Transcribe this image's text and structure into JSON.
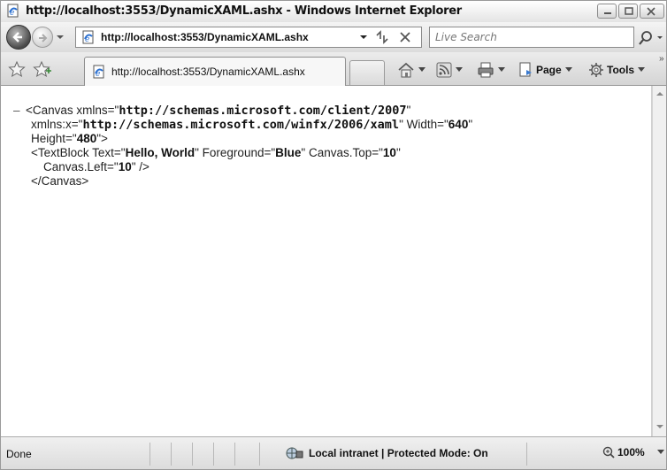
{
  "window": {
    "title": "http://localhost:3553/DynamicXAML.ashx - Windows Internet Explorer"
  },
  "address_bar": {
    "url": "http://localhost:3553/DynamicXAML.ashx"
  },
  "search": {
    "placeholder": "Live Search"
  },
  "tab": {
    "label": "http://localhost:3553/DynamicXAML.ashx"
  },
  "command_bar": {
    "page_label": "Page",
    "tools_label": "Tools"
  },
  "document": {
    "dash": "–",
    "line1": {
      "open": "<Canvas xmlns=\"",
      "value": "http://schemas.microsoft.com/client/2007",
      "close": "\""
    },
    "line2": {
      "attr": "xmlns:x=\"",
      "value": "http://schemas.microsoft.com/winfx/2006/xaml",
      "attr2": "\" Width=\"",
      "value2": "640",
      "close": "\""
    },
    "line3": {
      "attr": "Height=\"",
      "value": "480",
      "close": "\">"
    },
    "line4": {
      "open": "<TextBlock Text=\"",
      "value": "Hello, World",
      "attr2": "\" Foreground=\"",
      "value2": "Blue",
      "attr3": "\" Canvas.Top=\"",
      "value3": "10",
      "close": "\""
    },
    "line5": {
      "attr": "Canvas.Left=\"",
      "value": "10",
      "close": "\" />"
    },
    "line6": {
      "text": "</Canvas>"
    }
  },
  "status_bar": {
    "status_text": "Done",
    "zone_text": "Local intranet | Protected Mode: On",
    "zoom_text": "100%"
  },
  "icons": [
    "ie-page-icon",
    "minimize-icon",
    "maximize-icon",
    "close-icon",
    "back-arrow-icon",
    "forward-arrow-icon",
    "refresh-icon",
    "stop-icon",
    "search-icon",
    "favorites-star-icon",
    "add-favorites-icon",
    "home-icon",
    "feeds-icon",
    "print-icon",
    "page-icon",
    "tools-gear-icon",
    "zone-globe-icon",
    "zoom-icon"
  ]
}
